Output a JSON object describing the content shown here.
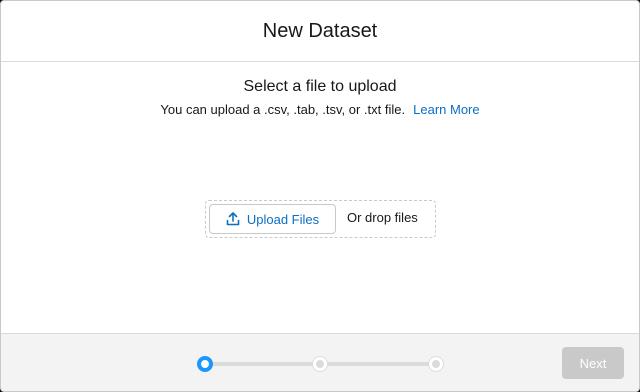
{
  "header": {
    "title": "New Dataset"
  },
  "body": {
    "heading": "Select a file to upload",
    "description": "You can upload a .csv, .tab, .tsv, or .txt file.",
    "learn_more": "Learn More",
    "upload_button": "Upload Files",
    "drop_text": "Or drop files",
    "upload_icon": "upload-icon"
  },
  "footer": {
    "progress": {
      "total_steps": 3,
      "current_step": 1
    },
    "next_button": "Next",
    "next_disabled": true
  },
  "colors": {
    "accent": "#0b6fc4",
    "active_step": "#1b96ff",
    "disabled_button": "#c9c9c9",
    "footer_bg": "#f3f3f3"
  }
}
